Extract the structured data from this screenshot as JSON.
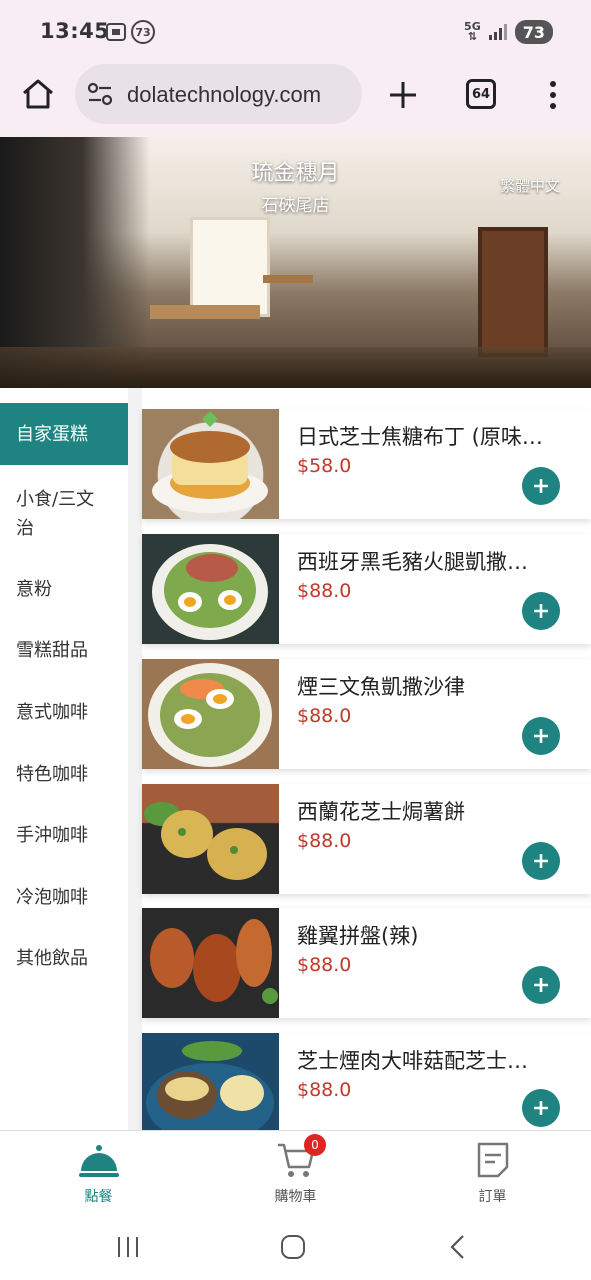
{
  "status_bar": {
    "time": "13:45",
    "notification_count": "73",
    "network": "5G",
    "battery": "73"
  },
  "browser": {
    "url": "dolatechnology.com",
    "tab_count": "64"
  },
  "banner": {
    "title": "琉金穗月",
    "subtitle": "石硤尾店",
    "language_button": "繁體中文"
  },
  "categories": [
    {
      "label": "自家蛋糕",
      "active": true
    },
    {
      "label": "小食/三文治",
      "active": false
    },
    {
      "label": "意粉",
      "active": false
    },
    {
      "label": "雪糕甜品",
      "active": false
    },
    {
      "label": "意式咖啡",
      "active": false
    },
    {
      "label": "特色咖啡",
      "active": false
    },
    {
      "label": "手沖咖啡",
      "active": false
    },
    {
      "label": "冷泡咖啡",
      "active": false
    },
    {
      "label": "其他飲品",
      "active": false
    }
  ],
  "products": [
    {
      "name": "日式芝士焦糖布丁 (原味…",
      "price": "$58.0"
    },
    {
      "name": "西班牙黑毛豬火腿凱撒…",
      "price": "$88.0"
    },
    {
      "name": "煙三文魚凱撒沙律",
      "price": "$88.0"
    },
    {
      "name": "西蘭花芝士焗薯餅",
      "price": "$88.0"
    },
    {
      "name": "雞翼拼盤(辣)",
      "price": "$88.0"
    },
    {
      "name": "芝士煙肉大啡菇配芝士…",
      "price": "$88.0"
    }
  ],
  "bottom_nav": {
    "order": "點餐",
    "cart": "購物車",
    "cart_count": "0",
    "orders": "訂單"
  },
  "colors": {
    "accent": "#1e8381",
    "price": "#c0392b",
    "badge": "#e02424"
  }
}
